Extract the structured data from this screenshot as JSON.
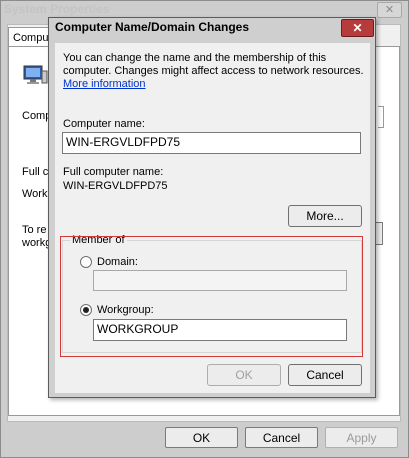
{
  "back_window": {
    "title": "System Properties",
    "close_glyph": "✕",
    "tab_label": "Compu",
    "frag_1": "Compu",
    "frag_2": "Full c",
    "frag_3": "Work",
    "frag_4": "To re",
    "frag_5": "workg",
    "ok_label": "OK",
    "cancel_label": "Cancel",
    "apply_label": "Apply"
  },
  "dialog": {
    "title": "Computer Name/Domain Changes",
    "close_glyph": "✕",
    "intro_line1": "You can change the name and the membership of this",
    "intro_line2": "computer. Changes might affect access to network resources.",
    "more_info_link": "More information",
    "computer_name_label": "Computer name:",
    "computer_name_value": "WIN-ERGVLDFPD75",
    "full_name_label": "Full computer name:",
    "full_name_value": "WIN-ERGVLDFPD75",
    "more_button": "More...",
    "member_of_label": "Member of",
    "domain_label": "Domain:",
    "domain_value": "",
    "workgroup_label": "Workgroup:",
    "workgroup_value": "WORKGROUP",
    "ok_label": "OK",
    "cancel_label": "Cancel"
  },
  "colors": {
    "highlight_border": "#d23a3a",
    "link": "#0033cc",
    "dialog_close": "#b63c3c"
  }
}
